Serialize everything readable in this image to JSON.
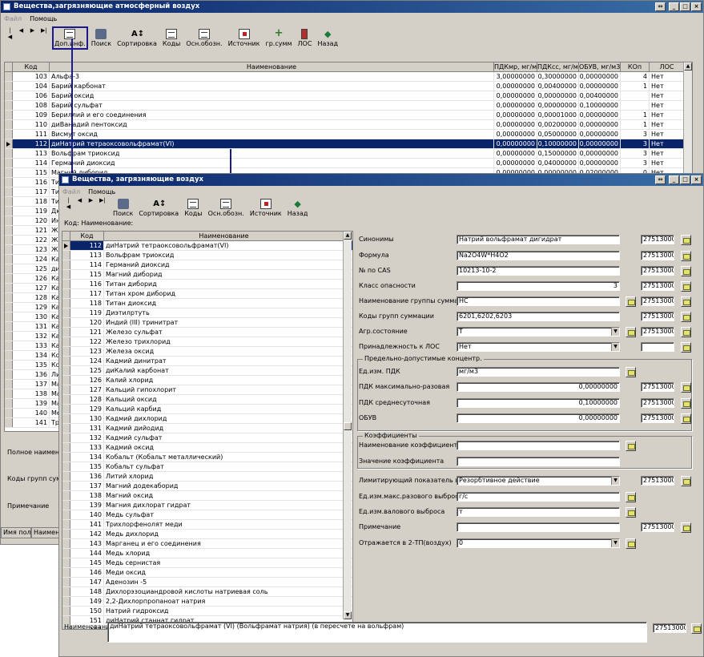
{
  "back_window": {
    "title": "Вещества,загрязняющие атмосферный воздух",
    "menu": [
      "Файл",
      "Помощь"
    ],
    "toolbar": [
      "Доп.инф.",
      "Поиск",
      "Сортировка",
      "Коды",
      "Осн.обозн.",
      "Источник",
      "гр.сумм",
      "ЛОС",
      "Назад"
    ],
    "columns": [
      "Код",
      "Наименование",
      "ПДКмр, мг/м3",
      "ПДКсс, мг/м3",
      "ОБУВ, мг/м3",
      "КОп",
      "ЛОС"
    ],
    "rows": [
      {
        "kod": "103",
        "name": "Альфа-3",
        "pdkmr": "3,00000000",
        "pdkss": "0,30000000",
        "obuv": "0,00000000",
        "kop": "4",
        "los": "Нет"
      },
      {
        "kod": "104",
        "name": "Барий карбонат",
        "pdkmr": "0,00000000",
        "pdkss": "0,00400000",
        "obuv": "0,00000000",
        "kop": "1",
        "los": "Нет"
      },
      {
        "kod": "106",
        "name": "Барий оксид",
        "pdkmr": "0,00000000",
        "pdkss": "0,00000000",
        "obuv": "0,00400000",
        "kop": "",
        "los": "Нет"
      },
      {
        "kod": "108",
        "name": "Барий сульфат",
        "pdkmr": "0,00000000",
        "pdkss": "0,00000000",
        "obuv": "0,10000000",
        "kop": "",
        "los": "Нет"
      },
      {
        "kod": "109",
        "name": "Бериллий и его соединения",
        "pdkmr": "0,00000000",
        "pdkss": "0,00001000",
        "obuv": "0,00000000",
        "kop": "1",
        "los": "Нет"
      },
      {
        "kod": "110",
        "name": "диВанадий пентоксид",
        "pdkmr": "0,00000000",
        "pdkss": "0,00200000",
        "obuv": "0,00000000",
        "kop": "1",
        "los": "Нет"
      },
      {
        "kod": "111",
        "name": "Висмут оксид",
        "pdkmr": "0,00000000",
        "pdkss": "0,05000000",
        "obuv": "0,00000000",
        "kop": "3",
        "los": "Нет"
      },
      {
        "kod": "112",
        "name": "диНатрий тетраоксовольфрамат(VI)",
        "pdkmr": "0,00000000",
        "pdkss": "0,10000000",
        "obuv": "0,00000000",
        "kop": "3",
        "los": "Нет"
      },
      {
        "kod": "113",
        "name": "Вольфрам триоксид",
        "pdkmr": "0,00000000",
        "pdkss": "0,15000000",
        "obuv": "0,00000000",
        "kop": "3",
        "los": "Нет"
      },
      {
        "kod": "114",
        "name": "Германий диоксид",
        "pdkmr": "0,00000000",
        "pdkss": "0,04000000",
        "obuv": "0,00000000",
        "kop": "3",
        "los": "Нет"
      },
      {
        "kod": "115",
        "name": "Магний диборид",
        "pdkmr": "0,00000000",
        "pdkss": "0,00000000",
        "obuv": "0,02000000",
        "kop": "0",
        "los": "Нет"
      }
    ],
    "left_rows": [
      {
        "kod": "116",
        "name": "Тит"
      },
      {
        "kod": "117",
        "name": "Тит"
      },
      {
        "kod": "118",
        "name": "Тит"
      },
      {
        "kod": "119",
        "name": "Дю"
      },
      {
        "kod": "120",
        "name": "Инд"
      },
      {
        "kod": "121",
        "name": "Жел"
      },
      {
        "kod": "122",
        "name": "Жел"
      },
      {
        "kod": "123",
        "name": "Жел"
      },
      {
        "kod": "124",
        "name": "Кад"
      },
      {
        "kod": "125",
        "name": "диК"
      },
      {
        "kod": "126",
        "name": "Кал"
      },
      {
        "kod": "127",
        "name": "Кал"
      },
      {
        "kod": "128",
        "name": "Кал"
      },
      {
        "kod": "129",
        "name": "Кал"
      },
      {
        "kod": "130",
        "name": "Кад"
      },
      {
        "kod": "131",
        "name": "Кад"
      },
      {
        "kod": "132",
        "name": "Кал"
      },
      {
        "kod": "133",
        "name": "Кад"
      },
      {
        "kod": "134",
        "name": "Ко"
      },
      {
        "kod": "135",
        "name": "Коб"
      },
      {
        "kod": "136",
        "name": "Лит"
      },
      {
        "kod": "137",
        "name": "Маг"
      },
      {
        "kod": "138",
        "name": "Маг"
      },
      {
        "kod": "139",
        "name": "Маг"
      },
      {
        "kod": "140",
        "name": "Мед"
      },
      {
        "kod": "141",
        "name": "Три"
      }
    ],
    "bottom_labels": [
      "Полное наименов",
      "Коды групп сумма",
      "Примечание"
    ],
    "status": [
      "Имя поля",
      "Наименов"
    ]
  },
  "front_window": {
    "title": "Вещества, загрязняющие воздух",
    "menu": [
      "Файл",
      "Помощь"
    ],
    "toolbar": [
      "Поиск",
      "Сортировка",
      "Коды",
      "Осн.обозн.",
      "Источник",
      "Назад"
    ],
    "filter_label": "Код: Наименование:",
    "columns": [
      "Код",
      "Наименование"
    ],
    "rows": [
      {
        "kod": "112",
        "name": "диНатрий тетраоксовольфрамат(VI)"
      },
      {
        "kod": "113",
        "name": "Вольфрам триоксид"
      },
      {
        "kod": "114",
        "name": "Германий диоксид"
      },
      {
        "kod": "115",
        "name": "Магний диборид"
      },
      {
        "kod": "116",
        "name": "Титан диборид"
      },
      {
        "kod": "117",
        "name": "Титан хром диборид"
      },
      {
        "kod": "118",
        "name": "Титан диоксид"
      },
      {
        "kod": "119",
        "name": "Диэтилртуть"
      },
      {
        "kod": "120",
        "name": "Индий (III) тринитрат"
      },
      {
        "kod": "121",
        "name": "Железо сульфат"
      },
      {
        "kod": "122",
        "name": "Железо трихлорид"
      },
      {
        "kod": "123",
        "name": "Железа оксид"
      },
      {
        "kod": "124",
        "name": "Кадмий динитрат"
      },
      {
        "kod": "125",
        "name": "диКалий карбонат"
      },
      {
        "kod": "126",
        "name": "Калий хлорид"
      },
      {
        "kod": "127",
        "name": "Кальций гипохлорит"
      },
      {
        "kod": "128",
        "name": "Кальций оксид"
      },
      {
        "kod": "129",
        "name": "Кальций карбид"
      },
      {
        "kod": "130",
        "name": "Кадмий дихлорид"
      },
      {
        "kod": "131",
        "name": "Кадмий дийодид"
      },
      {
        "kod": "132",
        "name": "Кадмий сульфат"
      },
      {
        "kod": "133",
        "name": "Кадмий оксид"
      },
      {
        "kod": "134",
        "name": "Кобальт (Кобальт металлический)"
      },
      {
        "kod": "135",
        "name": "Кобальт сульфат"
      },
      {
        "kod": "136",
        "name": "Литий хлорид"
      },
      {
        "kod": "137",
        "name": "Магний додекаборид"
      },
      {
        "kod": "138",
        "name": "Магний оксид"
      },
      {
        "kod": "139",
        "name": "Магния дихлорат гидрат"
      },
      {
        "kod": "140",
        "name": "Медь сульфат"
      },
      {
        "kod": "141",
        "name": "Трихлорфенолят меди"
      },
      {
        "kod": "142",
        "name": "Медь дихлорид"
      },
      {
        "kod": "143",
        "name": "Марганец и его соединения"
      },
      {
        "kod": "144",
        "name": "Медь хлорид"
      },
      {
        "kod": "145",
        "name": "Медь сернистая"
      },
      {
        "kod": "146",
        "name": "Меди оксид"
      },
      {
        "kod": "147",
        "name": "Аденозин -5"
      },
      {
        "kod": "148",
        "name": "Дихлорэзоциандровой кислоты натриевая соль"
      },
      {
        "kod": "149",
        "name": "2,2-Дихлорпропаноат натрия"
      },
      {
        "kod": "150",
        "name": "Натрий гидроксид"
      },
      {
        "kod": "151",
        "name": "диНатрий станнат гидрат"
      },
      {
        "kod": "152",
        "name": "Натрий хлорид"
      }
    ],
    "form": {
      "synonyms_label": "Синонимы",
      "synonyms": "Натрий вольфрамат дигидрат",
      "synonyms_code": "2751300000",
      "formula_label": "Формула",
      "formula": "Na2O4W*H4O2",
      "formula_code": "2751300000",
      "cas_label": "№ по CAS",
      "cas": "10213-10-2",
      "cas_code": "2751300000",
      "hazard_label": "Класс опасности",
      "hazard": "3",
      "hazard_code": "2751300000",
      "group_name_label": "Наименование группы суммации",
      "group_name": "НС",
      "group_name_code": "2751300000",
      "group_codes_label": "Коды групп суммации",
      "group_codes": "6201,6202,6203",
      "group_codes_code": "2751300000",
      "agg_label": "Агр.состояние",
      "agg": "Т",
      "agg_code": "2751300000",
      "los_label": "Принадлежность к ЛОС",
      "los": "Нет",
      "los_code": "",
      "pdk_group": "Предельно-допустимые концентр.",
      "unit_label": "Ед.изм. ПДК",
      "unit": "мг/м3",
      "pdk_mr_label": "ПДК максимально-разовая",
      "pdk_mr": "0,00000000",
      "pdk_mr_code": "2751300000",
      "pdk_ss_label": "ПДК среднесуточная",
      "pdk_ss": "0,10000000",
      "pdk_ss_code": "2751300000",
      "obuv_label": "ОБУВ",
      "obuv": "0,00000000",
      "obuv_code": "2751300000",
      "coef_group": "Коэффициенты",
      "coef_name_label": "Наименование коэффициента",
      "coef_name": "",
      "coef_value_label": "Значение коэффициента",
      "coef_value": "",
      "limit_label": "Лимитирующий показатель вред.",
      "limit": "Резорбтивное действие",
      "limit_code": "2751300000",
      "max_unit_label": "Ед.изм.макс.разового выброса",
      "max_unit": "г/с",
      "gross_unit_label": "Ед.изм.валового выброса",
      "gross_unit": "т",
      "note_label": "Примечание",
      "note": "",
      "note_code": "2751300000",
      "tp_label": "Отражается в 2-ТП(воздух)",
      "tp": "0"
    },
    "name_label": "Наименование",
    "name_value": "диНатрий тетраоксовольфрамат (VI) (Вольфрамат натрия) (в пересчете на вольфрам)",
    "name_code": "2751300000"
  }
}
